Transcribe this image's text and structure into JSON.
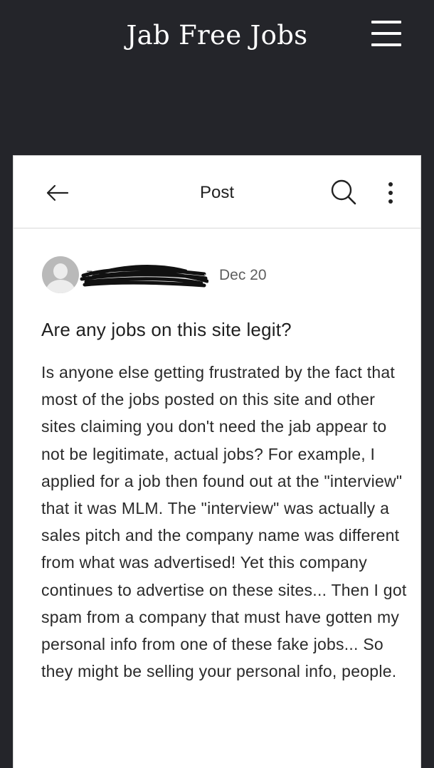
{
  "site": {
    "title": "Jab Free Jobs",
    "menu_icon": "hamburger-menu-icon"
  },
  "header": {
    "title": "Post",
    "back_icon": "arrow-left-icon",
    "search_icon": "search-icon",
    "more_icon": "more-vertical-icon"
  },
  "post": {
    "author": "ze",
    "author_redacted": true,
    "separator": "·",
    "date": "Dec 20",
    "title": "Are any jobs on this site legit?",
    "body": "Is anyone else getting frustrated by the fact that most of the jobs posted on this site and other sites claiming you don't need the jab appear to not be legitimate, actual jobs? For example, I applied for a job then found out at the \"interview\" that it was MLM. The \"interview\" was actually a sales pitch and the company name was different from what was advertised! Yet this company continues to advertise on these sites... Then I got spam from a company that must have gotten my personal info from one of these fake jobs... So they might be selling your personal info, people."
  },
  "colors": {
    "topbar": "#24252a",
    "card": "#ffffff",
    "text": "#2a2a2a",
    "meta": "#5e5e5e",
    "avatar": "#b9b9b9"
  }
}
